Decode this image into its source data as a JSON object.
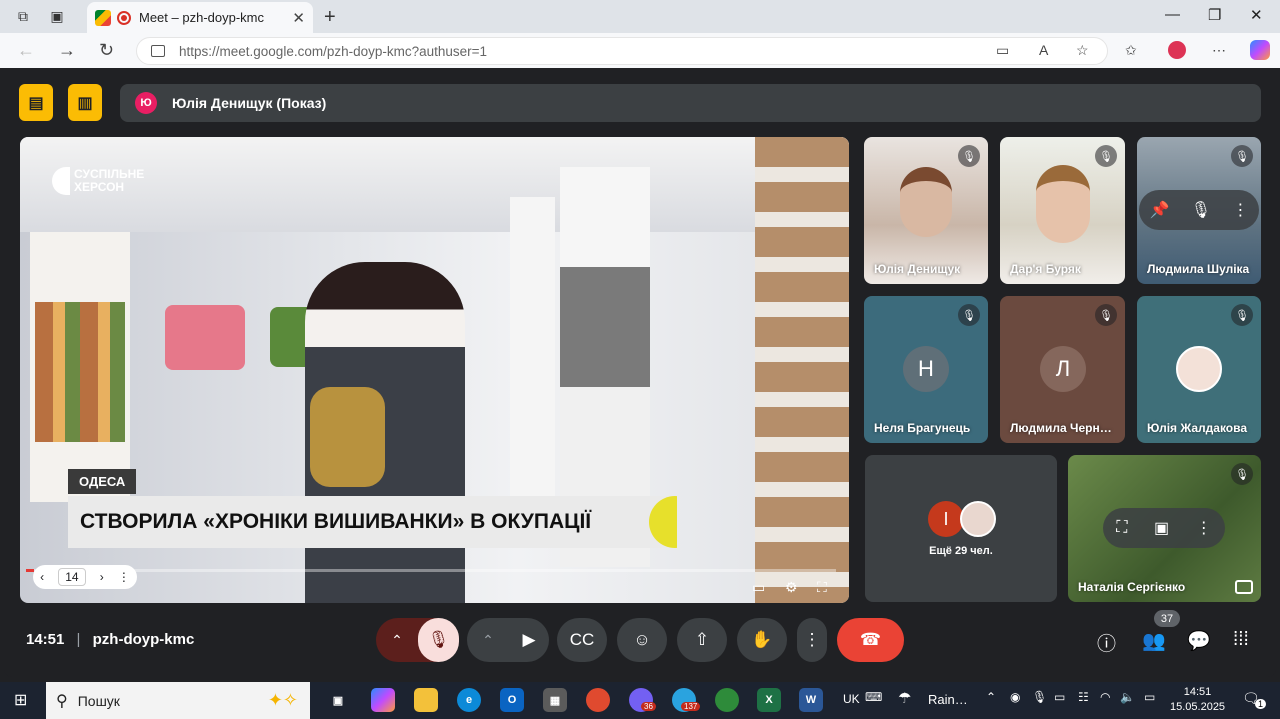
{
  "browser": {
    "tab_title": "Meet – pzh-doyp-kmc",
    "url_domain": "https://meet.google.com",
    "url_path": "/pzh-doyp-kmc?authuser=1"
  },
  "meet": {
    "presenter_initial": "Ю",
    "presenter_label": "Юлія Денищук (Показ)",
    "video": {
      "logo_line1": "СУСПІЛЬНЕ",
      "logo_line2": "ХЕРСОН",
      "city": "ОДЕСА",
      "headline": "СТВОРИЛА «ХРОНІКИ ВИШИВАНКИ» В ОКУПАЦІЇ",
      "page_number": "14"
    },
    "participants": [
      {
        "name": "Юлія Денищук"
      },
      {
        "name": "Дар'я Буряк"
      },
      {
        "name": "Людмила Шуліка"
      },
      {
        "name": "Неля Брагунець",
        "initial": "Н"
      },
      {
        "name": "Людмила Черн…",
        "initial": "Л"
      },
      {
        "name": "Юлія Жалдакова"
      },
      {
        "name": "Наталія Сергієнко"
      }
    ],
    "more": {
      "initial": "І",
      "label": "Ещё 29 чел."
    },
    "time": "14:51",
    "meeting_code": "pzh-doyp-kmc",
    "participants_count": "37"
  },
  "taskbar": {
    "search_placeholder": "Пошук",
    "lang": "UK",
    "weather": "Rain…",
    "clock_time": "14:51",
    "clock_date": "15.05.2025",
    "notif_count": "1",
    "badges": {
      "viber": "36",
      "telegram": "137"
    }
  },
  "colors": {
    "accent_yellow": "#fbbc04",
    "end_call": "#ea4335",
    "mute_red": "#f9dedc"
  }
}
